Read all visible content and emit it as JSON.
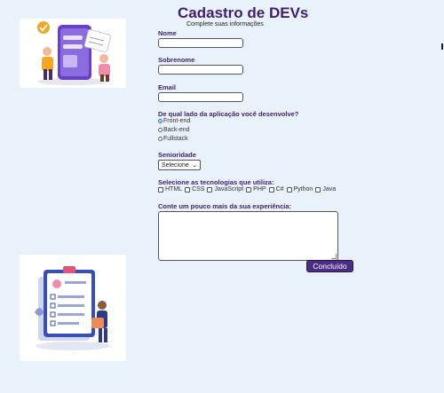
{
  "header": {
    "title": "Cadastro de DEVs",
    "subtitle": "Complete suas informações"
  },
  "form": {
    "name_label": "Nome",
    "surname_label": "Sobrenome",
    "email_label": "Email",
    "side_question": "De qual lado da aplicação você desenvolve?",
    "side_options": [
      "Front-end",
      "Back-end",
      "Fullstack"
    ],
    "side_selected": "Front-end",
    "seniority_label": "Senioridade",
    "seniority_value": "Selecione",
    "tech_label": "Selecione as tecnologias que utiliza:",
    "tech_options": [
      "HTML",
      "CSS",
      "JavaScript",
      "PHP",
      "C#",
      "Python",
      "Java"
    ],
    "experience_label": "Conte um pouco mais da sua experiência:",
    "submit_label": "Concluído"
  },
  "colors": {
    "background": "#e9f2fb",
    "heading": "#3d1f73",
    "button": "#4b2d86"
  }
}
